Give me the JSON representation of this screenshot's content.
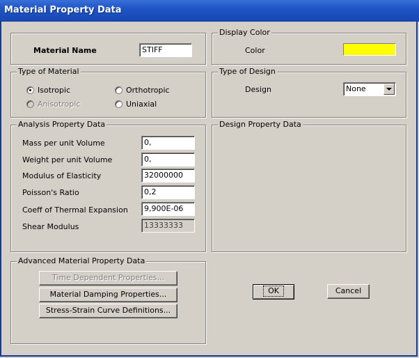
{
  "window": {
    "title": "Material Property Data"
  },
  "material_name": {
    "label": "Material Name",
    "value": "STIFF"
  },
  "display_color": {
    "legend": "Display Color",
    "label": "Color",
    "color": "#ffff00"
  },
  "type_of_material": {
    "legend": "Type of Material",
    "options": [
      {
        "label": "Isotropic",
        "checked": true,
        "enabled": true
      },
      {
        "label": "Orthotropic",
        "checked": false,
        "enabled": true
      },
      {
        "label": "Anisotropic",
        "checked": false,
        "enabled": false
      },
      {
        "label": "Uniaxial",
        "checked": false,
        "enabled": true
      }
    ]
  },
  "type_of_design": {
    "legend": "Type of Design",
    "label": "Design",
    "selected": "None"
  },
  "analysis": {
    "legend": "Analysis Property Data",
    "fields": [
      {
        "label": "Mass per unit Volume",
        "value": "0,"
      },
      {
        "label": "Weight per unit Volume",
        "value": "0,"
      },
      {
        "label": "Modulus of Elasticity",
        "value": "32000000"
      },
      {
        "label": "Poisson's Ratio",
        "value": "0,2"
      },
      {
        "label": "Coeff of Thermal Expansion",
        "value": "9,900E-06"
      },
      {
        "label": "Shear Modulus",
        "value": "13333333"
      }
    ]
  },
  "design_property": {
    "legend": "Design Property Data"
  },
  "advanced": {
    "legend": "Advanced Material Property Data",
    "buttons": [
      "Time Dependent Properties...",
      "Material Damping Properties...",
      "Stress-Strain Curve Definitions..."
    ]
  },
  "dialog_buttons": {
    "ok": "OK",
    "cancel": "Cancel"
  }
}
